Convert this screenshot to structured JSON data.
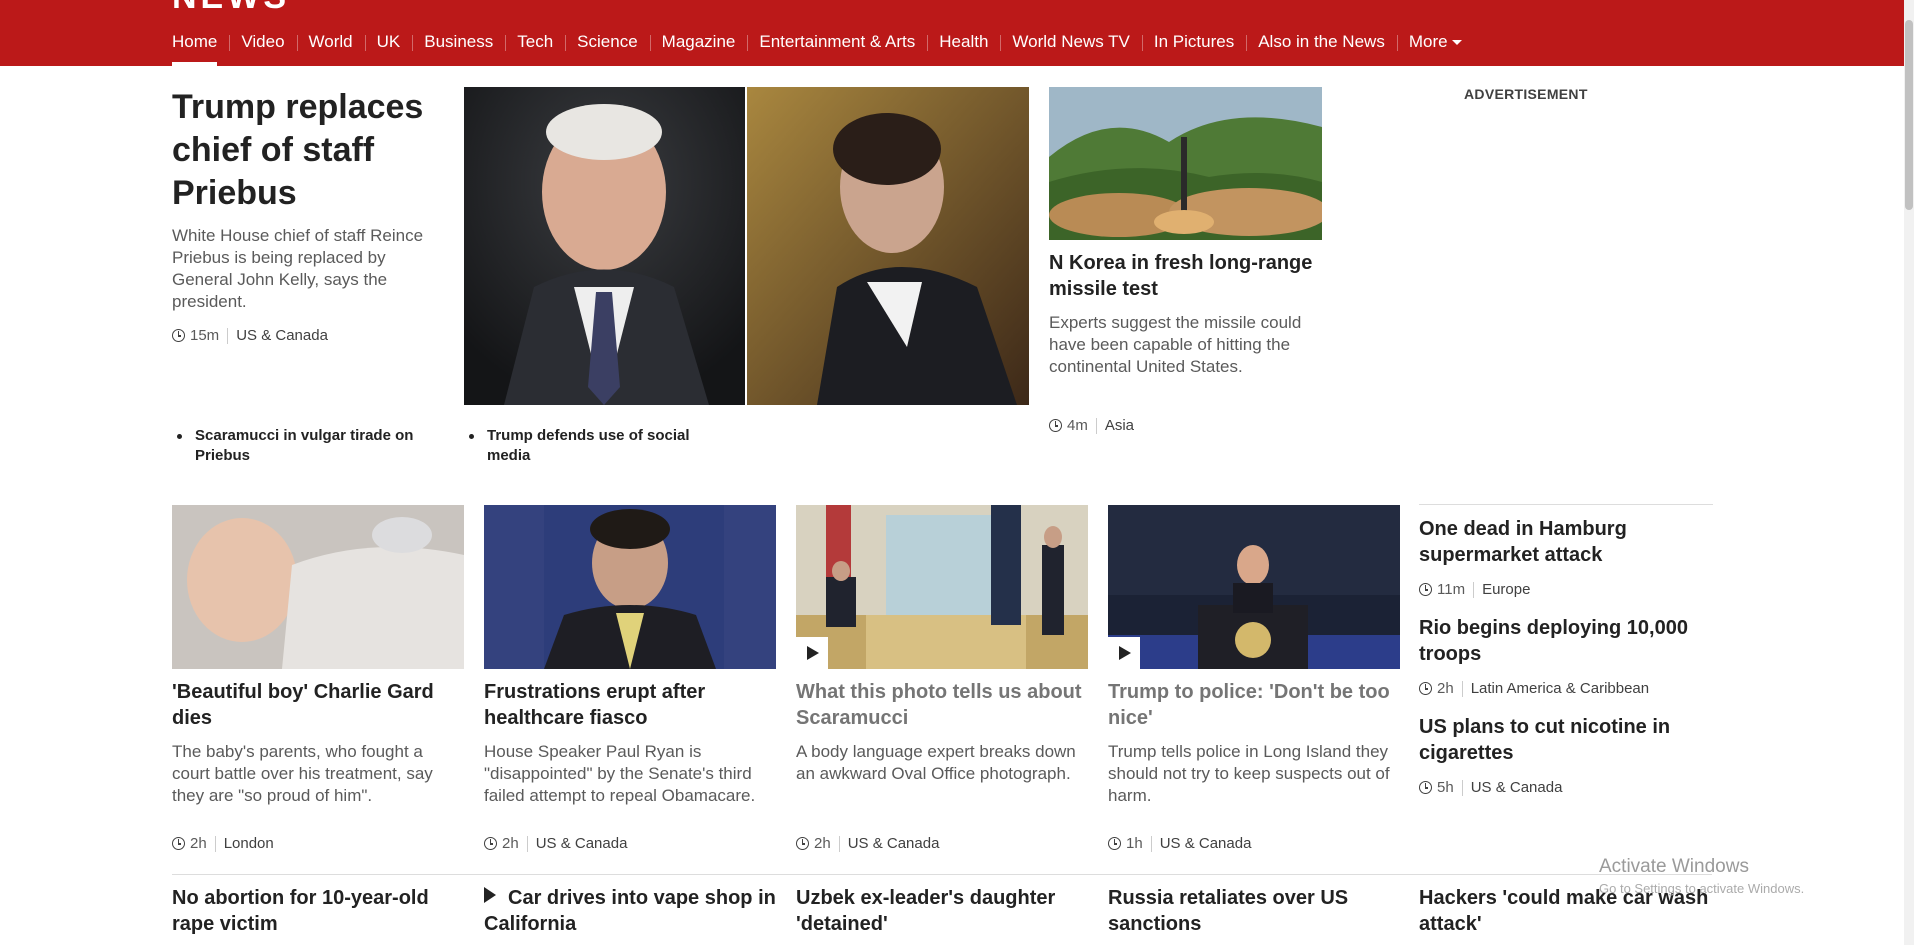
{
  "brand": {
    "logo_text": "NEWS"
  },
  "nav": [
    "Home",
    "Video",
    "World",
    "UK",
    "Business",
    "Tech",
    "Science",
    "Magazine",
    "Entertainment & Arts",
    "Health",
    "World News TV",
    "In Pictures",
    "Also in the News",
    "More"
  ],
  "lead": {
    "title": "Trump replaces chief of staff Priebus",
    "summary": "White House chief of staff Reince Priebus is being replaced by General John Kelly, says the president.",
    "time": "15m",
    "section": "US & Canada",
    "related": [
      "Scaramucci in vulgar tirade on Priebus",
      "Trump defends use of social media"
    ]
  },
  "secondary": {
    "title": "N Korea in fresh long-range missile test",
    "summary": "Experts suggest the missile could have been capable of hitting the continental United States.",
    "time": "4m",
    "section": "Asia"
  },
  "advertisement_label": "ADVERTISEMENT",
  "row2": [
    {
      "title": "'Beautiful boy' Charlie Gard dies",
      "summary": "The baby's parents, who fought a court battle over his treatment, say they are \"so proud of him\".",
      "time": "2h",
      "section": "London"
    },
    {
      "title": "Frustrations erupt after healthcare fiasco",
      "summary": "House Speaker Paul Ryan is \"disappointed\" by the Senate's third failed attempt to repeal Obamacare.",
      "time": "2h",
      "section": "US & Canada"
    },
    {
      "title": "What this photo tells us about Scaramucci",
      "summary": "A body language expert breaks down an awkward Oval Office photograph.",
      "time": "2h",
      "section": "US & Canada"
    },
    {
      "title": "Trump to police: 'Don't be too nice'",
      "summary": "Trump tells police in Long Island they should not try to keep suspects out of harm.",
      "time": "1h",
      "section": "US & Canada"
    }
  ],
  "side_list": [
    {
      "title": "One dead in Hamburg supermarket attack",
      "time": "11m",
      "section": "Europe"
    },
    {
      "title": "Rio begins deploying 10,000 troops",
      "time": "2h",
      "section": "Latin America & Caribbean"
    },
    {
      "title": "US plans to cut nicotine in cigarettes",
      "time": "5h",
      "section": "US & Canada"
    }
  ],
  "row3": [
    "No abortion for 10-year-old rape victim",
    "Car drives into vape shop in California",
    "Uzbek ex-leader's daughter 'detained'",
    "Russia retaliates over US sanctions",
    "Hackers 'could make car wash attack'"
  ],
  "windows": {
    "line1": "Activate Windows",
    "line2": "Go to Settings to activate Windows."
  }
}
